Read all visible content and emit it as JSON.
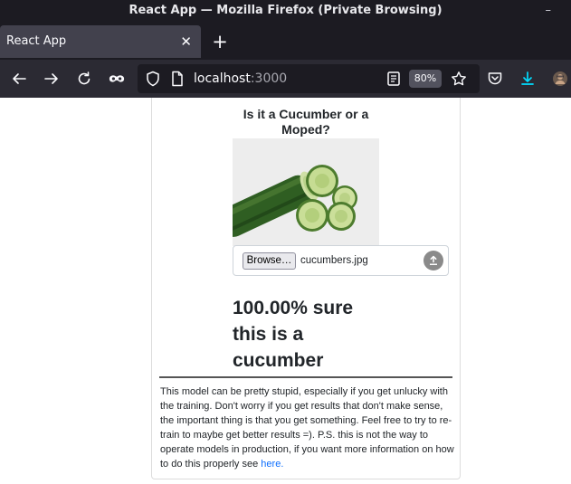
{
  "window": {
    "title": "React App — Mozilla Firefox (Private Browsing)",
    "minimize_glyph": "–"
  },
  "tabs": [
    {
      "label": "React App",
      "close_glyph": "✕"
    }
  ],
  "new_tab_glyph": "+",
  "navbar": {
    "url_host": "localhost",
    "url_port": ":3000",
    "zoom": "80%"
  },
  "app": {
    "title": "Is it a Cucumber or a Moped?",
    "browse_label": "Browse…",
    "file_name": "cucumbers.jpg",
    "result": "100.00% sure this is a cucumber",
    "disclaimer": "This model can be pretty stupid, especially if you get unlucky with the training. Don't worry if you get results that don't make sense, the important thing is that you get something. Feel free to try to re-train to maybe get better results =). P.S. this is not the way to operate models in production, if you want more information on how to do this properly see",
    "link_text": "here."
  },
  "icons": {
    "back": "arrow-left-icon",
    "forward": "arrow-right-icon",
    "reload": "reload-icon",
    "private": "private-browsing-mask-icon",
    "shield": "tracking-protection-shield-icon",
    "page": "page-info-icon",
    "reader": "reader-view-icon",
    "bookmark": "bookmark-star-icon",
    "pocket": "pocket-icon",
    "downloads": "download-icon",
    "account": "account-avatar-icon",
    "upload": "upload-icon"
  },
  "colors": {
    "chrome_dark": "#1c1b22",
    "toolbar": "#2b2a33",
    "tab_active": "#42414d",
    "download_accent": "#00ddff",
    "link": "#0d6efd"
  }
}
